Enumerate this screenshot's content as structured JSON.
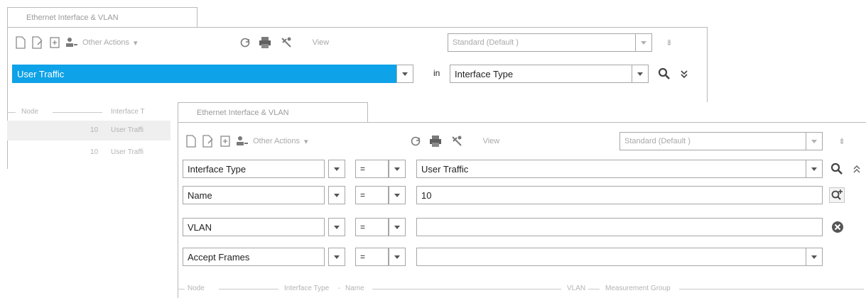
{
  "back_panel": {
    "tab_label": "Ethernet Interface & VLAN",
    "toolbar": {
      "other_actions_label": "Other Actions",
      "view_label": "View",
      "view_value": "Standard (Default )"
    },
    "filter": {
      "value": "User Traffic",
      "in_label": "in",
      "field": "Interface Type"
    },
    "columns": {
      "node": "Node",
      "interface_type": "Interface T"
    },
    "rows": [
      {
        "node": "10",
        "interface_type": "User Traffi"
      },
      {
        "node": "10",
        "interface_type": "User Traffi"
      }
    ]
  },
  "front_panel": {
    "tab_label": "Ethernet Interface & VLAN",
    "toolbar": {
      "other_actions_label": "Other Actions",
      "view_label": "View",
      "view_value": "Standard (Default )"
    },
    "filters": [
      {
        "field": "Interface Type",
        "operator": "=",
        "value": "User Traffic"
      },
      {
        "field": "Name",
        "operator": "=",
        "value": "10"
      },
      {
        "field": "VLAN",
        "operator": "=",
        "value": ""
      },
      {
        "field": "Accept Frames",
        "operator": "=",
        "value": ""
      }
    ],
    "columns": {
      "node": "Node",
      "interface_type": "Interface Type",
      "name": "Name",
      "vlan": "VLAN",
      "measurement_group": "Measurement Group"
    }
  },
  "icons": [
    "new-document-icon",
    "edit-document-icon",
    "add-row-icon",
    "other-actions-icon",
    "refresh-icon",
    "print-icon",
    "tools-icon",
    "search-icon",
    "add-search-icon",
    "clear-icon",
    "collapse-icon",
    "expand-icon"
  ],
  "colors": {
    "highlight": "#0ea2e8",
    "border": "#a7a7a7",
    "muted_text": "#a8a8a8"
  }
}
